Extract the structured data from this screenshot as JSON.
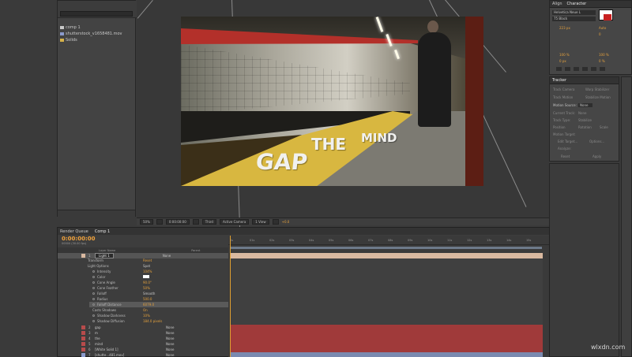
{
  "project": {
    "items": [
      {
        "name": "comp 1",
        "color": "#c8c8c8"
      },
      {
        "name": "shutterstock_v1658481.mov",
        "color": "#8a9acc"
      },
      {
        "name": "Solids",
        "color": "#d6b24a"
      }
    ]
  },
  "viewer": {
    "zoom": "50%",
    "timecode": "0:00:00:00",
    "view_mode": "Third",
    "camera": "Active Camera",
    "views": "1 View",
    "exposure": "+0.0",
    "title_words": {
      "gap": "GAP",
      "the": "THE",
      "mind": "MIND"
    }
  },
  "character": {
    "tabs": [
      "Align",
      "Character"
    ],
    "font": "Helvetica Neue L",
    "style": "75 Black",
    "size": "223 px",
    "leading": "Auto",
    "tracking": "0",
    "scale_v": "100 %",
    "scale_h": "100 %",
    "baseline": "0 px",
    "tsume": "0 %"
  },
  "tracker": {
    "tab": "Tracker",
    "buttons": [
      "Track Camera",
      "Warp Stabilizer",
      "Track Motion",
      "Stabilize Motion"
    ],
    "motion_source_label": "Motion Source:",
    "motion_source": "None",
    "current_track_label": "Current Track:",
    "current_track": "None",
    "track_type_label": "Track Type:",
    "track_type": "Stabilize",
    "options": [
      "Position",
      "Rotation",
      "Scale"
    ],
    "motion_target": "Motion Target:",
    "edit_target": "Edit Target...",
    "options_btn": "Options...",
    "analyze": "Analyze:",
    "reset": "Reset",
    "apply": "Apply"
  },
  "timeline": {
    "tabs": [
      "Render Queue",
      "Comp 1"
    ],
    "timecode": "0:00:00:00",
    "frames_info": "00000 (30.00 fps)",
    "columns": [
      "Layer Name",
      "Parent"
    ],
    "parent_none": "None",
    "ruler": [
      "0s",
      "01s",
      "02s",
      "03s",
      "04s",
      "05s",
      "06s",
      "07s",
      "08s",
      "09s",
      "10s",
      "11s",
      "12s",
      "13s",
      "14s",
      "15s"
    ],
    "light_layer": {
      "num": "1",
      "name": "Light 1"
    },
    "properties": [
      {
        "name": "Transform",
        "value": "Reset"
      },
      {
        "name": "Light Options",
        "value": "Spot"
      },
      {
        "name": "Intensity",
        "value": "104%"
      },
      {
        "name": "Color",
        "value": ""
      },
      {
        "name": "Cone Angle",
        "value": "90.0°"
      },
      {
        "name": "Cone Feather",
        "value": "50%"
      },
      {
        "name": "Falloff",
        "value": "Smooth"
      },
      {
        "name": "Radius",
        "value": "500.0"
      },
      {
        "name": "Falloff Distance",
        "value": "6079.0"
      },
      {
        "name": "Casts Shadows",
        "value": "On"
      },
      {
        "name": "Shadow Darkness",
        "value": "10%"
      },
      {
        "name": "Shadow Diffusion",
        "value": "184.0 pixels"
      }
    ],
    "layers": [
      {
        "num": "2",
        "name": "gap",
        "color": "#b74b4b"
      },
      {
        "num": "3",
        "name": "m",
        "color": "#b74b4b"
      },
      {
        "num": "4",
        "name": "the",
        "color": "#b74b4b"
      },
      {
        "num": "5",
        "name": "mind",
        "color": "#b74b4b"
      },
      {
        "num": "6",
        "name": "[White Solid 1]",
        "color": "#b74b4b"
      },
      {
        "num": "7",
        "name": "[shutte...481.mov]",
        "color": "#8a9acc"
      }
    ]
  },
  "watermark": "wlxdn.com"
}
